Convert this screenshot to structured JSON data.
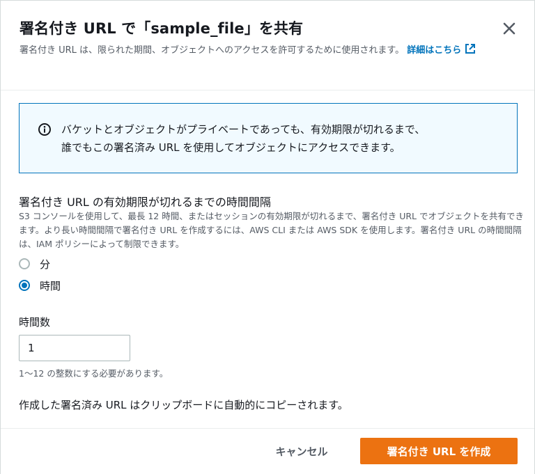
{
  "modal": {
    "title": "署名付き URL で「sample_file」を共有",
    "description": "署名付き URL は、限られた期間、オブジェクトへのアクセスを許可するために使用されます。",
    "learn_more_label": "詳細はこちら",
    "close_icon": "close-icon",
    "external_link_icon": "external-link-icon"
  },
  "alert": {
    "icon": "info-icon",
    "text_line1": "バケットとオブジェクトがプライベートであっても、有効期限が切れるまで、",
    "text_line2": "誰でもこの署名済み URL を使用してオブジェクトにアクセスできます。"
  },
  "interval": {
    "label": "署名付き URL の有効期限が切れるまでの時間間隔",
    "description": "S3 コンソールを使用して、最長 12 時間、またはセッションの有効期限が切れるまで、署名付き URL でオブジェクトを共有できます。より長い時間間隔で署名付き URL を作成するには、AWS CLI または AWS SDK を使用します。署名付き URL の時間間隔は、IAM ポリシーによって制限できます。",
    "options": [
      {
        "label": "分",
        "selected": false
      },
      {
        "label": "時間",
        "selected": true
      }
    ]
  },
  "hours_field": {
    "label": "時間数",
    "value": "1",
    "constraint": "1〜12 の整数にする必要があります。"
  },
  "note": "作成した署名済み URL はクリップボードに自動的にコピーされます。",
  "footer": {
    "cancel_label": "キャンセル",
    "create_label": "署名付き URL を作成"
  },
  "colors": {
    "primary_button": "#ec7211",
    "link": "#0073bb",
    "alert_border": "#0073bb",
    "alert_background": "#f1faff"
  }
}
